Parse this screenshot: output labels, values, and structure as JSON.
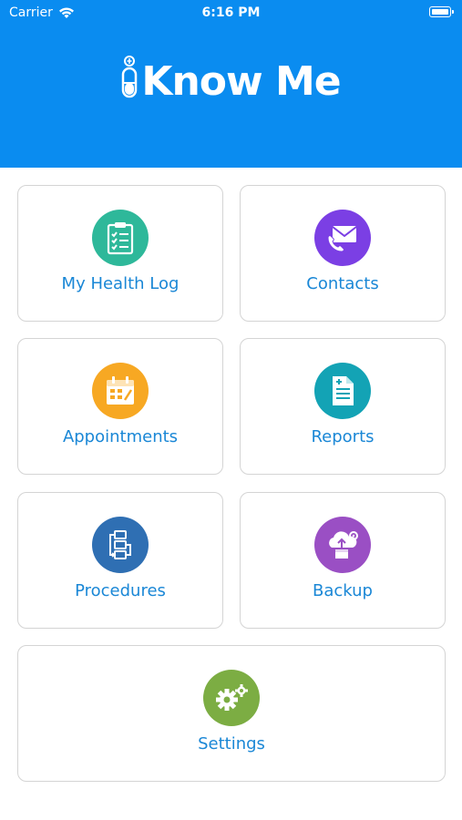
{
  "status_bar": {
    "carrier": "Carrier",
    "time": "6:16 PM"
  },
  "header": {
    "brand_prefix": "i",
    "brand_name": "Know Me",
    "color": "#0a8cf0"
  },
  "tiles": [
    {
      "label": "My Health Log",
      "icon": "clipboard-checklist-icon",
      "color": "#2eb89a"
    },
    {
      "label": "Contacts",
      "icon": "envelope-phone-icon",
      "color": "#7b3fe4"
    },
    {
      "label": "Appointments",
      "icon": "calendar-icon",
      "color": "#f7a823"
    },
    {
      "label": "Reports",
      "icon": "document-icon",
      "color": "#13a3b5"
    },
    {
      "label": "Procedures",
      "icon": "flowchart-icon",
      "color": "#2f6fb3"
    },
    {
      "label": "Backup",
      "icon": "cloud-upload-icon",
      "color": "#9a4fc4"
    },
    {
      "label": "Settings",
      "icon": "gears-icon",
      "color": "#7cad43"
    }
  ]
}
